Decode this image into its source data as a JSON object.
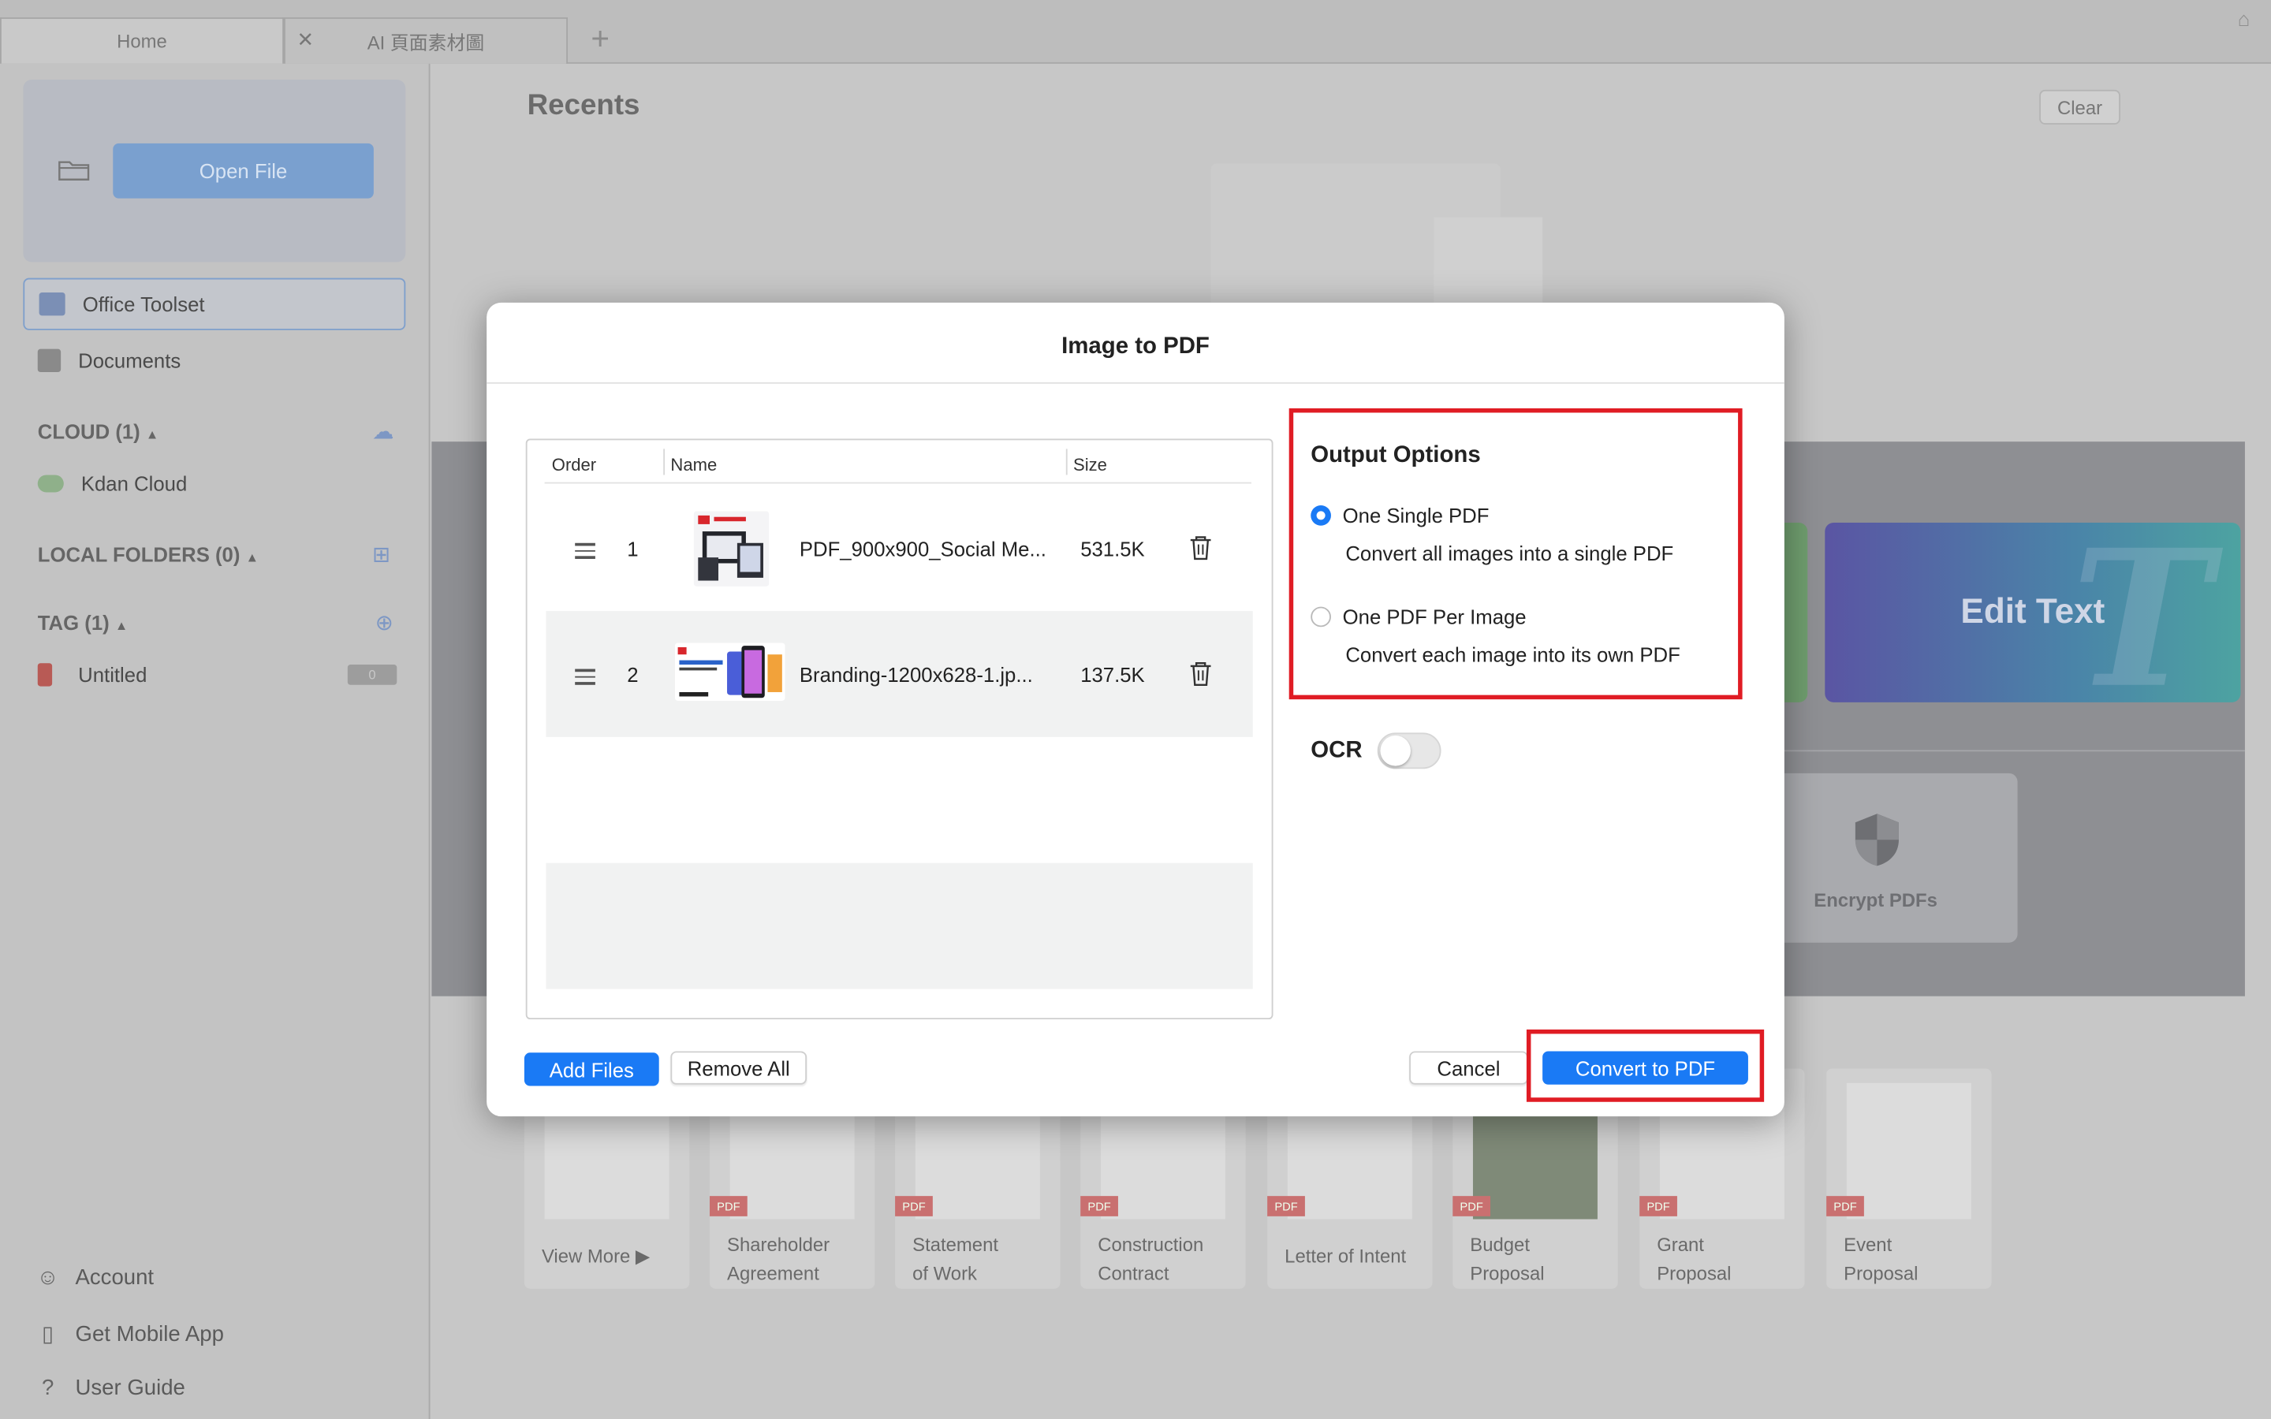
{
  "tabs": [
    {
      "label": "Home"
    },
    {
      "label": "AI 頁面素材圖"
    }
  ],
  "sidebar": {
    "open_file": "Open File",
    "nav": [
      {
        "label": "Office Toolset",
        "icon": "briefcase-icon"
      },
      {
        "label": "Documents",
        "icon": "calendar-icon"
      }
    ],
    "cloud_header": "CLOUD (1)",
    "cloud_items": [
      {
        "label": "Kdan Cloud"
      }
    ],
    "local_header": "LOCAL FOLDERS (0)",
    "tag_header": "TAG (1)",
    "tags": [
      {
        "label": "Untitled",
        "count": "0"
      }
    ],
    "bottom": [
      {
        "label": "Account",
        "icon": "person-icon"
      },
      {
        "label": "Get Mobile App",
        "icon": "mobile-icon"
      },
      {
        "label": "User Guide",
        "icon": "question-icon"
      }
    ]
  },
  "main": {
    "recents_title": "Recents",
    "clear_label": "Clear",
    "edit_text_label": "Edit Text",
    "encrypt_label": "Encrypt PDFs",
    "templates": [
      {
        "lines": [
          "View More ▶"
        ]
      },
      {
        "lines": [
          "Shareholder",
          "Agreement"
        ],
        "badge": "PDF"
      },
      {
        "lines": [
          "Statement",
          "of Work"
        ],
        "badge": "PDF"
      },
      {
        "lines": [
          "Construction",
          "Contract"
        ],
        "badge": "PDF"
      },
      {
        "lines": [
          "Letter of Intent"
        ],
        "badge": "PDF"
      },
      {
        "lines": [
          "Budget",
          "Proposal"
        ],
        "badge": "PDF"
      },
      {
        "lines": [
          "Grant",
          "Proposal"
        ],
        "badge": "PDF"
      },
      {
        "lines": [
          "Event",
          "Proposal"
        ],
        "badge": "PDF"
      }
    ]
  },
  "dialog": {
    "title": "Image to PDF",
    "columns": {
      "order": "Order",
      "name": "Name",
      "size": "Size"
    },
    "files": [
      {
        "order": "1",
        "name": "PDF_900x900_Social Me...",
        "size": "531.5K"
      },
      {
        "order": "2",
        "name": "Branding-1200x628-1.jp...",
        "size": "137.5K"
      }
    ],
    "add_files": "Add Files",
    "remove_all": "Remove All",
    "output_title": "Output Options",
    "options": [
      {
        "label": "One Single PDF",
        "desc": "Convert all images into a single PDF",
        "selected": true
      },
      {
        "label": "One PDF Per Image",
        "desc": "Convert each image into its own PDF",
        "selected": false
      }
    ],
    "ocr_label": "OCR",
    "ocr_enabled": false,
    "cancel": "Cancel",
    "convert": "Convert to PDF"
  },
  "colors": {
    "accent": "#1a7af5",
    "highlight": "#e01c24"
  }
}
